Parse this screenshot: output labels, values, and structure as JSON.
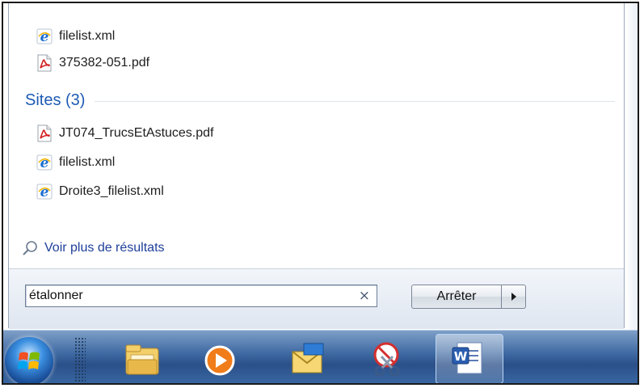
{
  "results": {
    "top_items": [
      {
        "label": "filelist.xml",
        "icon": "ie-icon"
      },
      {
        "label": "375382-051.pdf",
        "icon": "pdf-icon"
      }
    ],
    "sites_header": "Sites (3)",
    "sites_items": [
      {
        "label": "JT074_TrucsEtAstuces.pdf",
        "icon": "pdf-icon"
      },
      {
        "label": "filelist.xml",
        "icon": "ie-icon"
      },
      {
        "label": "Droite3_filelist.xml",
        "icon": "ie-icon"
      }
    ],
    "more_results": "Voir plus de résultats"
  },
  "search": {
    "value": "étalonner",
    "clear_glyph": "×"
  },
  "shutdown": {
    "label": "Arrêter"
  },
  "taskbar": {
    "pinned": [
      "windows-explorer-icon",
      "media-player-icon",
      "outlook-icon",
      "snipping-tool-icon",
      "word-icon"
    ]
  },
  "colors": {
    "group_title": "#1e5bb4",
    "link": "#1e3f9a",
    "pdf_red": "#d2201f",
    "ie_blue": "#1d6fd1"
  }
}
